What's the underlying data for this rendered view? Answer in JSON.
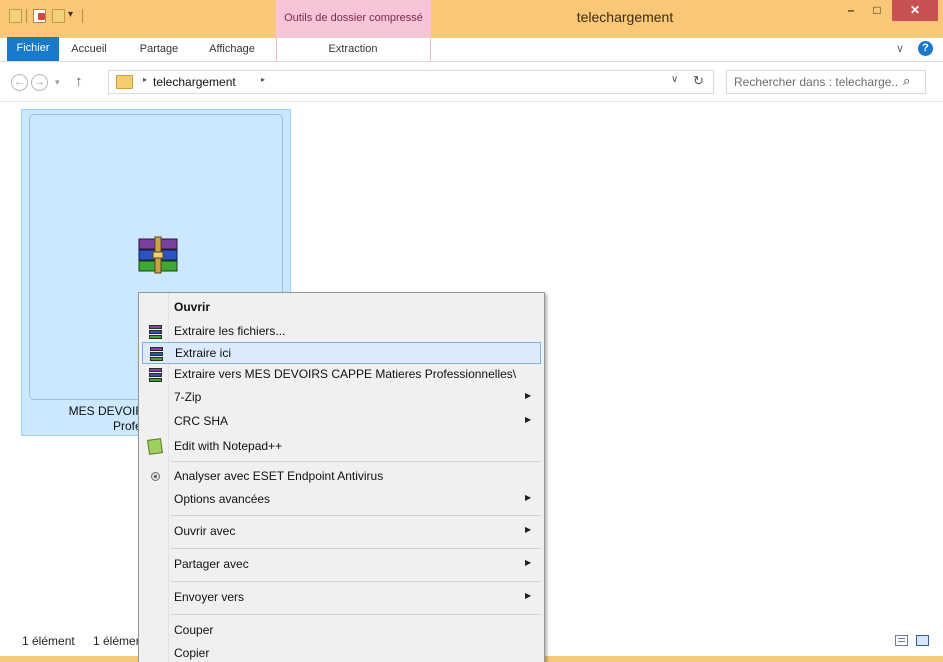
{
  "window": {
    "title": "telechargement",
    "contextual_group": "Outils de dossier compressé",
    "minimize": "–",
    "maximize": "□",
    "close": "✕"
  },
  "ribbon": {
    "tabs": [
      {
        "label": "Fichier",
        "active": true
      },
      {
        "label": "Accueil"
      },
      {
        "label": "Partage"
      },
      {
        "label": "Affichage"
      },
      {
        "label": "Extraction"
      }
    ],
    "expand_icon": "chevron-down-icon",
    "help": "?"
  },
  "address": {
    "back": "←",
    "forward": "→",
    "recent": "▾",
    "up": "↑",
    "crumb": "telechargement",
    "arrow": "▸",
    "dropdown": "∨",
    "refresh": "↻"
  },
  "search": {
    "placeholder": "Rechercher dans : telecharge...",
    "icon": "⌕"
  },
  "file": {
    "name_line1": "MES DEVOIRS CAPPE Matieres",
    "name_line2": "Professionnelles",
    "icon": "winrar-archive-icon"
  },
  "status": {
    "count": "1 élément",
    "selected": "1 élément sélectionné"
  },
  "context_menu": {
    "items": [
      {
        "label": "Ouvrir",
        "bold": true
      },
      {
        "label": "Extraire les fichiers...",
        "icon": "winrar-icon"
      },
      {
        "label": "Extraire ici",
        "icon": "winrar-icon",
        "highlighted": true
      },
      {
        "label": "Extraire vers MES DEVOIRS CAPPE Matieres Professionnelles\\",
        "icon": "winrar-icon"
      },
      {
        "label": "7-Zip",
        "submenu": true
      },
      {
        "label": "CRC SHA",
        "submenu": true
      },
      {
        "label": "Edit with Notepad++",
        "icon": "notepad-plus-plus-icon"
      },
      {
        "label": "Analyser avec ESET Endpoint Antivirus",
        "icon": "eset-icon"
      },
      {
        "label": "Options avancées",
        "submenu": true
      },
      {
        "label": "Ouvrir avec",
        "submenu": true
      },
      {
        "label": "Partager avec",
        "submenu": true
      },
      {
        "label": "Envoyer vers",
        "submenu": true
      },
      {
        "label": "Couper"
      },
      {
        "label": "Copier"
      }
    ],
    "submenu_arrow": "▶"
  },
  "colors": {
    "titlebar": "#f8c777",
    "accent": "#1979ca",
    "selection": "#cce8ff",
    "close": "#c75050"
  }
}
